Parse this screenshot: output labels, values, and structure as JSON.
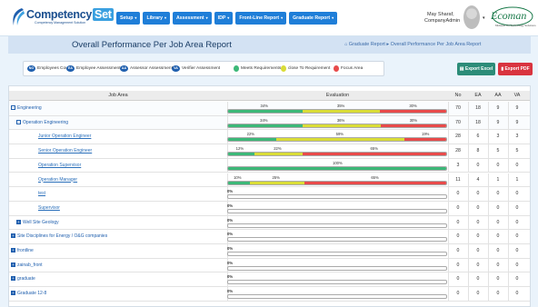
{
  "header": {
    "logo_main": "Competency",
    "logo_set": "Set",
    "logo_sub": "Competency Management Solution",
    "nav": [
      {
        "label": "Setup"
      },
      {
        "label": "Library"
      },
      {
        "label": "Assessment"
      },
      {
        "label": "IDP"
      },
      {
        "label": "Front-Line Report"
      },
      {
        "label": "Graduate Report"
      }
    ],
    "user_name": "May Sharaf,",
    "user_role": "CompanyAdmin",
    "partner_logo": "Ecoman",
    "partner_sub": "Midwest Oil Technology Solutions"
  },
  "titlebar": {
    "title": "Overall Performance Per Job Area Report",
    "breadcrumb_parent": "Graduate Report",
    "breadcrumb_current": "Overall Performance Per Job Area Report"
  },
  "legend": {
    "items": [
      {
        "abbr": "NO",
        "label": "Employees Count"
      },
      {
        "abbr": "EA",
        "label": "Employee Assessment"
      },
      {
        "abbr": "AA",
        "label": "Assessor Assessment"
      },
      {
        "abbr": "VA",
        "label": "Verifier Assessment"
      }
    ],
    "status": [
      {
        "label": "Meets Requirements",
        "color": "#3cb878"
      },
      {
        "label": "close To Requirement",
        "color": "#d9dc37"
      },
      {
        "label": "Focus Area",
        "color": "#e84a4a"
      }
    ]
  },
  "actions": {
    "excel": "Export Excel",
    "pdf": "Export PDF"
  },
  "table": {
    "headers": {
      "job_area": "Job Area",
      "evaluation": "Evaluation",
      "no": "No",
      "ea": "EA",
      "aa": "AA",
      "va": "VA"
    },
    "rows": [
      {
        "name": "Engineering",
        "toggle": "⊟",
        "indent": 0,
        "link": false,
        "green": 34,
        "yellow": 35,
        "red": 30,
        "no": "70",
        "ea": "18",
        "aa": "9",
        "va": "9"
      },
      {
        "name": "Operation Engineering",
        "toggle": "⊟",
        "indent": 1,
        "link": false,
        "green": 34,
        "yellow": 36,
        "red": 30,
        "no": "70",
        "ea": "18",
        "aa": "9",
        "va": "9"
      },
      {
        "name": "Junior Operation Engineer",
        "toggle": "",
        "indent": 2,
        "link": true,
        "green": 22,
        "yellow": 59,
        "red": 19,
        "no": "28",
        "ea": "6",
        "aa": "3",
        "va": "3"
      },
      {
        "name": "Senior Operation Engineer",
        "toggle": "",
        "indent": 2,
        "link": true,
        "green": 12,
        "yellow": 22,
        "red": 65,
        "no": "28",
        "ea": "8",
        "aa": "5",
        "va": "5"
      },
      {
        "name": "Operation Supervisor",
        "toggle": "",
        "indent": 2,
        "link": true,
        "green": 100,
        "yellow": 0,
        "red": 0,
        "no": "3",
        "ea": "0",
        "aa": "0",
        "va": "0"
      },
      {
        "name": "Operation Manager",
        "toggle": "",
        "indent": 2,
        "link": true,
        "green": 10,
        "yellow": 25,
        "red": 65,
        "no": "11",
        "ea": "4",
        "aa": "1",
        "va": "1"
      },
      {
        "name": "test",
        "toggle": "",
        "indent": 2,
        "link": true,
        "green": 0,
        "yellow": 0,
        "red": 0,
        "no": "0",
        "ea": "0",
        "aa": "0",
        "va": "0"
      },
      {
        "name": "Supervisor",
        "toggle": "",
        "indent": 2,
        "link": true,
        "green": 0,
        "yellow": 0,
        "red": 0,
        "no": "0",
        "ea": "0",
        "aa": "0",
        "va": "0"
      },
      {
        "name": "Well Site Geology",
        "toggle": "+",
        "indent": 1,
        "link": false,
        "green": 0,
        "yellow": 0,
        "red": 0,
        "no": "0",
        "ea": "0",
        "aa": "0",
        "va": "0"
      },
      {
        "name": "Site Disciplines for Energy / O&G companies",
        "toggle": "+",
        "indent": 0,
        "link": false,
        "green": 0,
        "yellow": 0,
        "red": 0,
        "no": "0",
        "ea": "0",
        "aa": "0",
        "va": "0"
      },
      {
        "name": "frontline",
        "toggle": "+",
        "indent": 0,
        "link": false,
        "green": 0,
        "yellow": 0,
        "red": 0,
        "no": "0",
        "ea": "0",
        "aa": "0",
        "va": "0"
      },
      {
        "name": "zainab_front",
        "toggle": "+",
        "indent": 0,
        "link": false,
        "green": 0,
        "yellow": 0,
        "red": 0,
        "no": "0",
        "ea": "0",
        "aa": "0",
        "va": "0"
      },
      {
        "name": "graduate",
        "toggle": "+",
        "indent": 0,
        "link": false,
        "green": 0,
        "yellow": 0,
        "red": 0,
        "no": "0",
        "ea": "0",
        "aa": "0",
        "va": "0"
      },
      {
        "name": "Graduate 12-8",
        "toggle": "+",
        "indent": 0,
        "link": false,
        "green": 0,
        "yellow": 0,
        "red": 0,
        "no": "0",
        "ea": "0",
        "aa": "0",
        "va": "0"
      }
    ]
  },
  "colors": {
    "green": "#3cb878",
    "yellow": "#d9dc37",
    "red": "#e84a4a",
    "nav": "#1f7ed8",
    "brand": "#1b4f8f"
  }
}
